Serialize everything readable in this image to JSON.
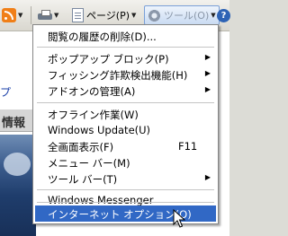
{
  "toolbar": {
    "page_label": "ページ(P)",
    "tools_label": "ツール(O)"
  },
  "background": {
    "link_text": "プ",
    "tab_label": "情報"
  },
  "menu": {
    "items": [
      {
        "label": "閲覧の履歴の削除(D)...",
        "arrow": "",
        "accel": ""
      },
      {
        "label": "ポップアップ ブロック(P)",
        "arrow": "▶",
        "accel": ""
      },
      {
        "label": "フィッシング詐欺検出機能(H)",
        "arrow": "▶",
        "accel": ""
      },
      {
        "label": "アドオンの管理(A)",
        "arrow": "▶",
        "accel": ""
      },
      {
        "label": "オフライン作業(W)",
        "arrow": "",
        "accel": ""
      },
      {
        "label": "Windows Update(U)",
        "arrow": "",
        "accel": ""
      },
      {
        "label": "全画面表示(F)",
        "arrow": "",
        "accel": "F11"
      },
      {
        "label": "メニュー バー(M)",
        "arrow": "",
        "accel": ""
      },
      {
        "label": "ツール バー(T)",
        "arrow": "▶",
        "accel": ""
      },
      {
        "label": "Windows Messenger",
        "arrow": "",
        "accel": ""
      },
      {
        "label": "インターネット オプション(O)",
        "arrow": "",
        "accel": "",
        "highlighted": true
      }
    ]
  },
  "colors": {
    "highlight": "#3168c5",
    "link": "#1a3fa8"
  }
}
